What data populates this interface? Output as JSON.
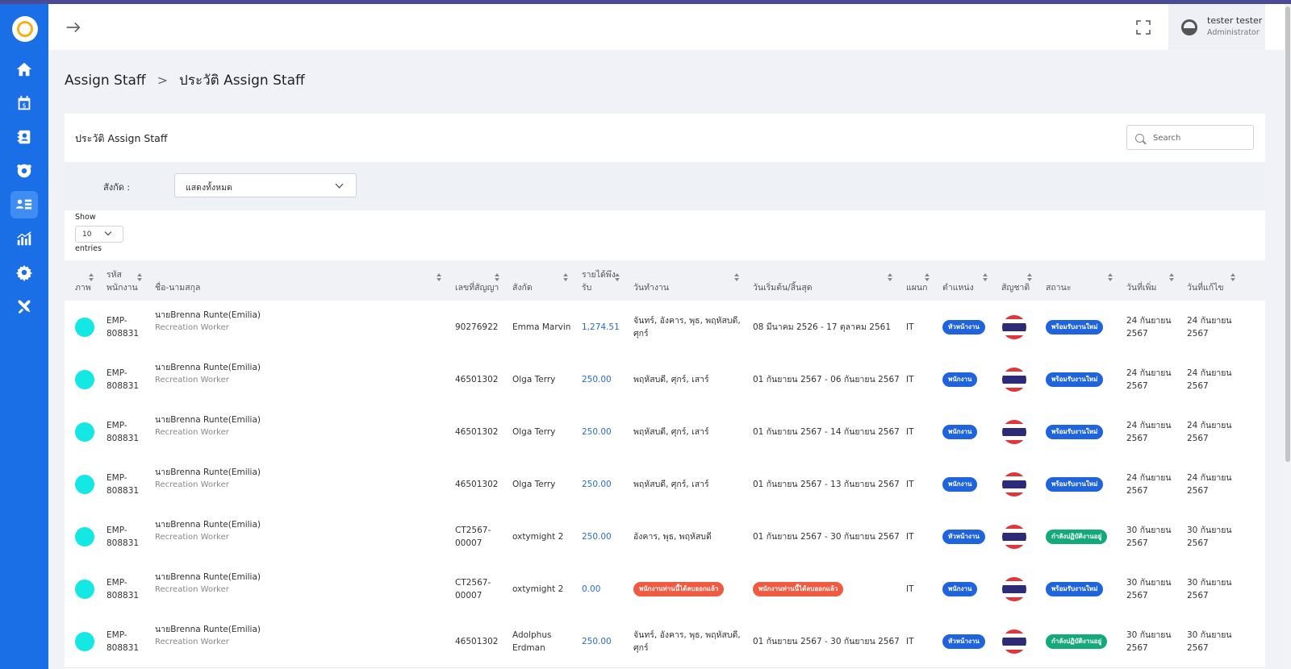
{
  "user": {
    "name": "tester tester",
    "role": "Administrator"
  },
  "breadcrumb": {
    "root": "Assign Staff",
    "separator": ">",
    "current": "ประวัติ Assign Staff"
  },
  "card": {
    "title": "ประวัติ Assign Staff"
  },
  "search": {
    "placeholder": "Search"
  },
  "filter": {
    "label": "สังกัด :",
    "value": "แสดงทั้งหมด"
  },
  "entries": {
    "show_label": "Show",
    "value": "10",
    "suffix": "entries"
  },
  "table": {
    "headers": {
      "photo": "ภาพ",
      "emp_code": "รหัส\nพนักงาน",
      "name": "ชื่อ-นามสกุล",
      "contract": "เลขที่สัญญา",
      "affiliation": "สังกัด",
      "income": "รายได้พึง\nรับ",
      "workdays": "วันทำงาน",
      "period": "วันเริ่มต้น/สิ้นสุด",
      "dept": "แผนก",
      "position": "ตำแหน่ง",
      "nationality": "สัญชาติ",
      "status": "สถานะ",
      "date_added": "วันที่เพิ่ม",
      "date_edited": "วันที่แก้ไข"
    },
    "rows": [
      {
        "emp_code": "EMP-\n808831",
        "name": "นายBrenna Runte(Emilia)",
        "job": "Recreation Worker",
        "contract": "90276922",
        "affiliation": "Emma Marvin",
        "income": "1,274.51",
        "workdays": "จันทร์, อังคาร, พุธ, พฤหัสบดี,\nศุกร์",
        "period": "08 มีนาคม 2526 - 17 ตุลาคม 2561",
        "dept": "IT",
        "position": "หัวหน้างาน",
        "status": "พร้อมรับงานใหม่",
        "status_color": "blue",
        "date_added": "24 กันยายน\n2567",
        "date_edited": "24 กันยายน\n2567"
      },
      {
        "emp_code": "EMP-\n808831",
        "name": "นายBrenna Runte(Emilia)",
        "job": "Recreation Worker",
        "contract": "46501302",
        "affiliation": "Olga Terry",
        "income": "250.00",
        "workdays": "พฤหัสบดี, ศุกร์, เสาร์",
        "period": "01 กันยายน 2567 - 06 กันยายน 2567",
        "dept": "IT",
        "position": "พนักงาน",
        "status": "พร้อมรับงานใหม่",
        "status_color": "blue",
        "date_added": "24 กันยายน\n2567",
        "date_edited": "24 กันยายน\n2567"
      },
      {
        "emp_code": "EMP-\n808831",
        "name": "นายBrenna Runte(Emilia)",
        "job": "Recreation Worker",
        "contract": "46501302",
        "affiliation": "Olga Terry",
        "income": "250.00",
        "workdays": "พฤหัสบดี, ศุกร์, เสาร์",
        "period": "01 กันยายน 2567 - 14 กันยายน 2567",
        "dept": "IT",
        "position": "พนักงาน",
        "status": "พร้อมรับงานใหม่",
        "status_color": "blue",
        "date_added": "24 กันยายน\n2567",
        "date_edited": "24 กันยายน\n2567"
      },
      {
        "emp_code": "EMP-\n808831",
        "name": "นายBrenna Runte(Emilia)",
        "job": "Recreation Worker",
        "contract": "46501302",
        "affiliation": "Olga Terry",
        "income": "250.00",
        "workdays": "พฤหัสบดี, ศุกร์, เสาร์",
        "period": "01 กันยายน 2567 - 13 กันยายน 2567",
        "dept": "IT",
        "position": "พนักงาน",
        "status": "พร้อมรับงานใหม่",
        "status_color": "blue",
        "date_added": "24 กันยายน\n2567",
        "date_edited": "24 กันยายน\n2567"
      },
      {
        "emp_code": "EMP-\n808831",
        "name": "นายBrenna Runte(Emilia)",
        "job": "Recreation Worker",
        "contract": "CT2567-\n00007",
        "affiliation": "oxtymight 2",
        "income": "250.00",
        "workdays": "อังคาร, พุธ, พฤหัสบดี",
        "period": "01 กันยายน 2567 - 30 กันยายน 2567",
        "dept": "IT",
        "position": "หัวหน้างาน",
        "status": "กำลังปฏิบัติงานอยู่",
        "status_color": "teal",
        "date_added": "30 กันยายน\n2567",
        "date_edited": "30 กันยายน\n2567"
      },
      {
        "emp_code": "EMP-\n808831",
        "name": "นายBrenna Runte(Emilia)",
        "job": "Recreation Worker",
        "contract": "CT2567-\n00007",
        "affiliation": "oxtymight 2",
        "income": "0.00",
        "workdays_badge": "พนักงานท่านนี้ได้ลบออกแล้ว",
        "period_badge": "พนักงานท่านนี้ได้ลบออกแล้ว",
        "dept": "IT",
        "position": "พนักงาน",
        "status": "พร้อมรับงานใหม่",
        "status_color": "blue",
        "date_added": "30 กันยายน\n2567",
        "date_edited": "30 กันยายน\n2567"
      },
      {
        "emp_code": "EMP-\n808831",
        "name": "นายBrenna Runte(Emilia)",
        "job": "Recreation Worker",
        "contract": "46501302",
        "affiliation": "Adolphus\nErdman",
        "income": "250.00",
        "workdays": "จันทร์, อังคาร, พุธ, พฤหัสบดี,\nศุกร์",
        "period": "01 กันยายน 2567 - 30 กันยายน 2567",
        "dept": "IT",
        "position": "หัวหน้างาน",
        "status": "กำลังปฏิบัติงานอยู่",
        "status_color": "teal",
        "date_added": "30 กันยายน\n2567",
        "date_edited": "30 กันยายน\n2567"
      }
    ]
  },
  "icons": {
    "sidebar": [
      "home-icon",
      "calendar-money-icon",
      "contact-book-icon",
      "team-gear-icon",
      "assign-staff-icon",
      "chart-icon",
      "settings-icon",
      "tools-icon"
    ],
    "topbar": [
      "arrow-right-icon",
      "fullscreen-icon"
    ]
  },
  "colors": {
    "sidebar": "#1b6fe6",
    "badge_blue": "#1f64dc",
    "badge_teal": "#13a978",
    "badge_red": "#ef5a40",
    "photo": "#14e8e4",
    "income": "#2a6ad6"
  }
}
